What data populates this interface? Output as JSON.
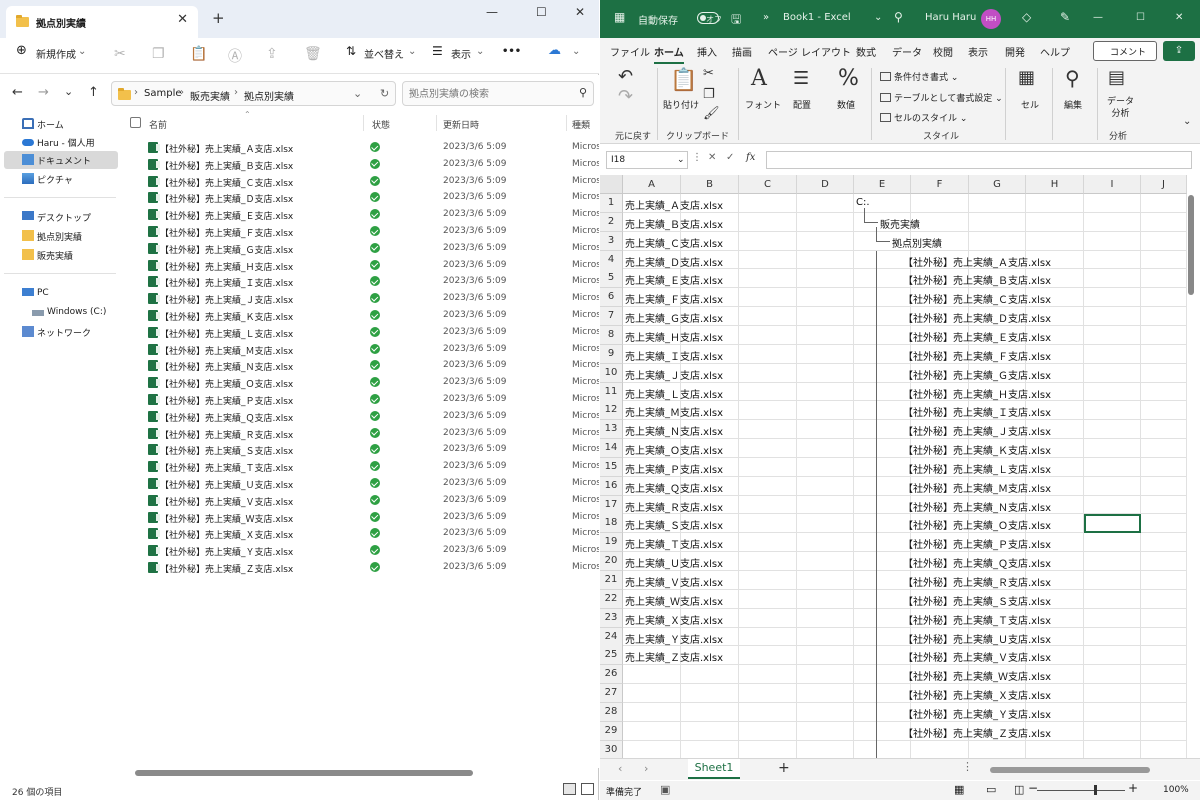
{
  "explorer": {
    "tab_title": "拠点別実績",
    "toolbar": {
      "new": "新規作成",
      "sort": "並べ替え",
      "view": "表示",
      "more": "•••"
    },
    "breadcrumb": [
      "Sample",
      "販売実績",
      "拠点別実績"
    ],
    "search_placeholder": "拠点別実績の検索",
    "nav": [
      "ホーム",
      "Haru - 個人用",
      "ドキュメント",
      "ピクチャ",
      "デスクトップ",
      "拠点別実績",
      "販売実績",
      "PC",
      "Windows (C:)",
      "ネットワーク"
    ],
    "columns": {
      "name": "名前",
      "status": "状態",
      "date": "更新日時",
      "type": "種類"
    },
    "files": [
      "【社外秘】売上実績_Ａ支店.xlsx",
      "【社外秘】売上実績_Ｂ支店.xlsx",
      "【社外秘】売上実績_Ｃ支店.xlsx",
      "【社外秘】売上実績_Ｄ支店.xlsx",
      "【社外秘】売上実績_Ｅ支店.xlsx",
      "【社外秘】売上実績_Ｆ支店.xlsx",
      "【社外秘】売上実績_Ｇ支店.xlsx",
      "【社外秘】売上実績_Ｈ支店.xlsx",
      "【社外秘】売上実績_Ｉ支店.xlsx",
      "【社外秘】売上実績_Ｊ支店.xlsx",
      "【社外秘】売上実績_Ｋ支店.xlsx",
      "【社外秘】売上実績_Ｌ支店.xlsx",
      "【社外秘】売上実績_Ｍ支店.xlsx",
      "【社外秘】売上実績_Ｎ支店.xlsx",
      "【社外秘】売上実績_Ｏ支店.xlsx",
      "【社外秘】売上実績_Ｐ支店.xlsx",
      "【社外秘】売上実績_Ｑ支店.xlsx",
      "【社外秘】売上実績_Ｒ支店.xlsx",
      "【社外秘】売上実績_Ｓ支店.xlsx",
      "【社外秘】売上実績_Ｔ支店.xlsx",
      "【社外秘】売上実績_Ｕ支店.xlsx",
      "【社外秘】売上実績_Ｖ支店.xlsx",
      "【社外秘】売上実績_Ｗ支店.xlsx",
      "【社外秘】売上実績_Ｘ支店.xlsx",
      "【社外秘】売上実績_Ｙ支店.xlsx",
      "【社外秘】売上実績_Ｚ支店.xlsx"
    ],
    "file_date": "2023/3/6 5:09",
    "file_type": "Micros",
    "status_count": "26 個の項目"
  },
  "excel": {
    "autosave": "自動保存",
    "autosave_state": "オフ",
    "book": "Book1 - Excel",
    "user": "Haru Haru",
    "avatar": "HH",
    "tabs": [
      "ファイル",
      "ホーム",
      "挿入",
      "描画",
      "ページ レイアウト",
      "数式",
      "データ",
      "校閲",
      "表示",
      "開発",
      "ヘルプ"
    ],
    "active_tab": "ホーム",
    "comment_btn": "コメント",
    "ribbon": {
      "undo": "元に戻す",
      "paste": "貼り付け",
      "clipboard": "クリップボード",
      "font": "フォント",
      "align": "配置",
      "number": "数値",
      "cond": "条件付き書式",
      "table": "テーブルとして書式設定",
      "cellstyle": "セルのスタイル",
      "style": "スタイル",
      "cell": "セル",
      "edit": "編集",
      "analyze": "データ\n分析",
      "analysis": "分析"
    },
    "namebox": "I18",
    "columns": [
      "A",
      "B",
      "C",
      "D",
      "E",
      "F",
      "G",
      "H",
      "I",
      "J"
    ],
    "colA": [
      "売上実績_Ａ支店.xlsx",
      "売上実績_Ｂ支店.xlsx",
      "売上実績_Ｃ支店.xlsx",
      "売上実績_Ｄ支店.xlsx",
      "売上実績_Ｅ支店.xlsx",
      "売上実績_Ｆ支店.xlsx",
      "売上実績_Ｇ支店.xlsx",
      "売上実績_Ｈ支店.xlsx",
      "売上実績_Ｉ支店.xlsx",
      "売上実績_Ｊ支店.xlsx",
      "売上実績_Ｌ支店.xlsx",
      "売上実績_Ｍ支店.xlsx",
      "売上実績_Ｎ支店.xlsx",
      "売上実績_Ｏ支店.xlsx",
      "売上実績_Ｐ支店.xlsx",
      "売上実績_Ｑ支店.xlsx",
      "売上実績_Ｒ支店.xlsx",
      "売上実績_Ｓ支店.xlsx",
      "売上実績_Ｔ支店.xlsx",
      "売上実績_Ｕ支店.xlsx",
      "売上実績_Ｖ支店.xlsx",
      "売上実績_Ｗ支店.xlsx",
      "売上実績_Ｘ支店.xlsx",
      "売上実績_Ｙ支店.xlsx",
      "売上実績_Ｚ支店.xlsx"
    ],
    "colE_root": "C:.",
    "colE_l1": "販売実績",
    "colE_l2": "拠点別実績",
    "colE_files": [
      "【社外秘】売上実績_Ａ支店.xlsx",
      "【社外秘】売上実績_Ｂ支店.xlsx",
      "【社外秘】売上実績_Ｃ支店.xlsx",
      "【社外秘】売上実績_Ｄ支店.xlsx",
      "【社外秘】売上実績_Ｅ支店.xlsx",
      "【社外秘】売上実績_Ｆ支店.xlsx",
      "【社外秘】売上実績_Ｇ支店.xlsx",
      "【社外秘】売上実績_Ｈ支店.xlsx",
      "【社外秘】売上実績_Ｉ支店.xlsx",
      "【社外秘】売上実績_Ｊ支店.xlsx",
      "【社外秘】売上実績_Ｋ支店.xlsx",
      "【社外秘】売上実績_Ｌ支店.xlsx",
      "【社外秘】売上実績_Ｍ支店.xlsx",
      "【社外秘】売上実績_Ｎ支店.xlsx",
      "【社外秘】売上実績_Ｏ支店.xlsx",
      "【社外秘】売上実績_Ｐ支店.xlsx",
      "【社外秘】売上実績_Ｑ支店.xlsx",
      "【社外秘】売上実績_Ｒ支店.xlsx",
      "【社外秘】売上実績_Ｓ支店.xlsx",
      "【社外秘】売上実績_Ｔ支店.xlsx",
      "【社外秘】売上実績_Ｕ支店.xlsx",
      "【社外秘】売上実績_Ｖ支店.xlsx",
      "【社外秘】売上実績_Ｗ支店.xlsx",
      "【社外秘】売上実績_Ｘ支店.xlsx",
      "【社外秘】売上実績_Ｙ支店.xlsx",
      "【社外秘】売上実績_Ｚ支店.xlsx"
    ],
    "sheet": "Sheet1",
    "status": "準備完了",
    "zoom": "100%"
  }
}
